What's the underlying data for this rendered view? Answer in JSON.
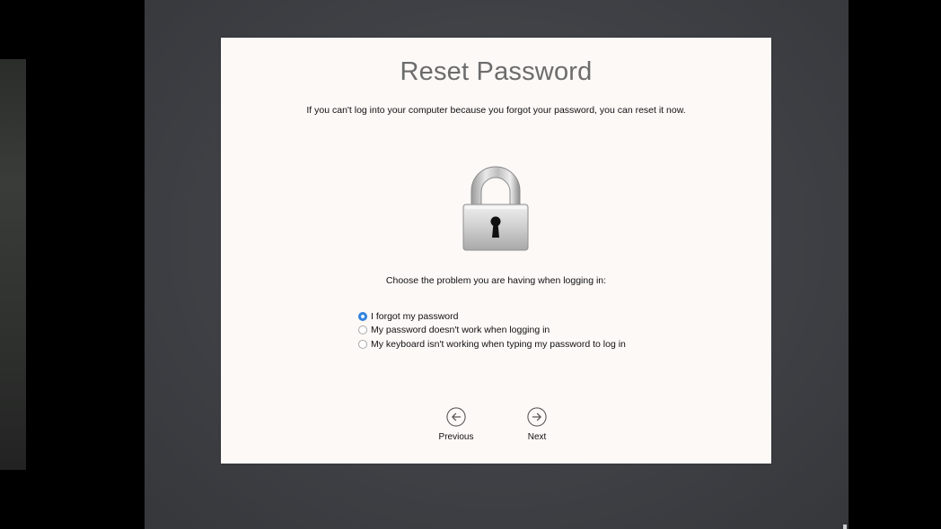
{
  "dialog": {
    "title": "Reset Password",
    "subtitle": "If you can't log into your computer because you forgot your password, you can reset it now.",
    "lock_icon": "padlock-icon",
    "prompt": "Choose the problem you are having when logging in:",
    "options": [
      {
        "label": "I forgot my password",
        "selected": true
      },
      {
        "label": "My password doesn't work when logging in",
        "selected": false
      },
      {
        "label": "My keyboard isn't working when typing my password to log in",
        "selected": false
      }
    ],
    "previous": {
      "label": "Previous",
      "icon": "arrow-left-circle-icon"
    },
    "next": {
      "label": "Next",
      "icon": "arrow-right-circle-icon"
    }
  },
  "colors": {
    "dialog_bg": "#fcf9f7",
    "screen_bg": "#3f4146",
    "accent": "#2f7fd8",
    "title_text": "#6c6c6c"
  }
}
